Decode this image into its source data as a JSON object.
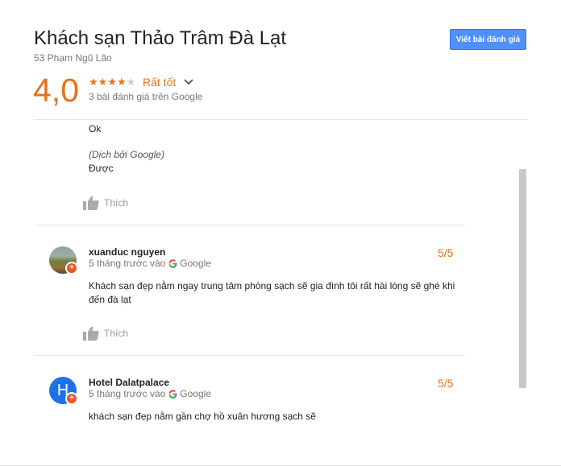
{
  "header": {
    "title": "Khách sạn Thảo Trâm Đà Lạt",
    "address": "53 Phạm Ngũ Lão",
    "write_review_label": "Viết bài đánh giá",
    "score": "4,0",
    "stars": "★★★★",
    "star_empty": "★",
    "rating_word": "Rất tốt",
    "review_count": "3 bài đánh giá trên Google",
    "star_rating": 4,
    "accent_color": "#e7711b"
  },
  "reviews": [
    {
      "text": "Ok",
      "translated_label": "(Dịch bởi Google)",
      "translated_text": "Được",
      "like_label": "Thích"
    },
    {
      "author": "xuanduc nguyen",
      "time": "5 tháng trước vào",
      "source": "Google",
      "score": "5/5",
      "text_line1": "Khách sạn đẹp nằm ngay trung tâm phòng sạch sẽ gia đình tôi rất hài lòng sẽ ghé khi",
      "text_line2": "đến đà lạt",
      "like_label": "Thích",
      "badge": "+"
    },
    {
      "author": "Hotel Dalatpalace",
      "avatar_letter": "H",
      "time": "5 tháng trước vào",
      "source": "Google",
      "score": "5/5",
      "text": "khách sạn đẹp nằm gần chợ hồ xuân hương sạch sẽ",
      "badge": "+"
    }
  ],
  "icons": {
    "chevron": "chevron-down-icon",
    "like": "thumbs-up-icon",
    "google": "google-g-icon"
  }
}
